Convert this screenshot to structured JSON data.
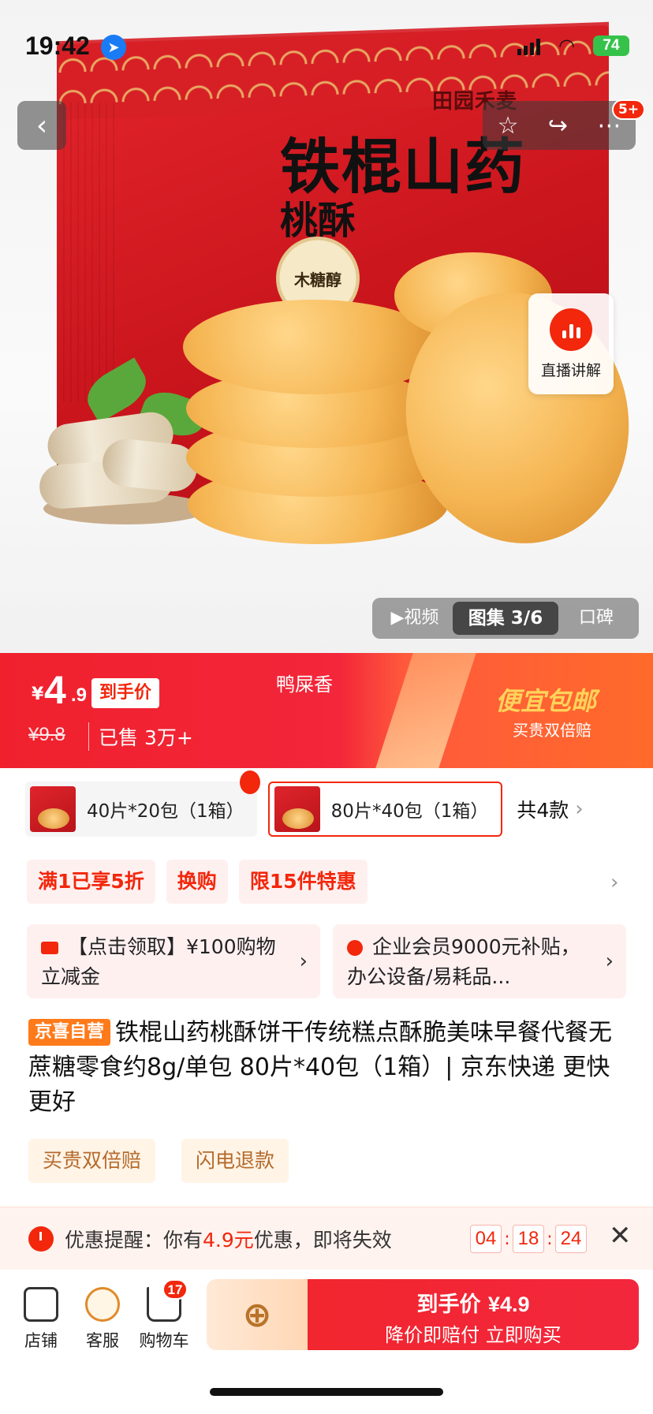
{
  "status_bar": {
    "time": "19:42",
    "battery": "74"
  },
  "nav": {
    "back_icon": "chevron-left-icon",
    "badge": "5+"
  },
  "product_image": {
    "brand_logo": "田园禾麦",
    "pack_title_1": "铁棍山药",
    "pack_title_2": "桃酥",
    "seal_text": "木糖醇"
  },
  "live": {
    "label": "直播讲解"
  },
  "media_tabs": [
    {
      "label": "▶视频",
      "active": false
    },
    {
      "label": "图集 3/6",
      "active": true
    },
    {
      "label": "口碑",
      "active": false
    }
  ],
  "price_bar": {
    "currency": "¥",
    "price_int": "4",
    "price_dec": ".9",
    "price_tag": "到手价",
    "original_price": "¥9.8",
    "sold": "已售 3万+",
    "scent": "鸭屎香",
    "promo_big": "便宜包邮",
    "promo_small": "买贵双倍赔"
  },
  "variants": {
    "options": [
      {
        "label": "40片*20包（1箱）",
        "selected": false
      },
      {
        "label": "80片*40包（1箱）",
        "selected": true
      }
    ],
    "count_label": "共4款"
  },
  "promo_tags": [
    "满1已享5折",
    "换购",
    "限15件特惠"
  ],
  "coupons": [
    {
      "text": "【点击领取】¥100购物立减金"
    },
    {
      "text": "企业会员9000元补贴，办公设备/易耗品..."
    }
  ],
  "title": {
    "badge": "京喜自营",
    "text": "铁棍山药桃酥饼干传统糕点酥脆美味早餐代餐无蔗糖零食约8g/单包 80片*40包（1箱）| 京东快递 更快更好"
  },
  "services": [
    "买贵双倍赔",
    "闪电退款"
  ],
  "reminder": {
    "prefix": "优惠提醒：你有",
    "amount": "4.9元",
    "suffix": "优惠，即将失效",
    "timer": [
      "04",
      "18",
      "24"
    ]
  },
  "bottom_bar": {
    "store": "店铺",
    "service": "客服",
    "cart": "购物车",
    "cart_badge": "17",
    "buy_title": "到手价",
    "buy_price": "¥4.9",
    "buy_sub": "降价即赔付 立即购买"
  },
  "colors": {
    "accent": "#f2270c",
    "brand_orange": "#ff7a1a",
    "promo_gold": "#ffd35a"
  }
}
